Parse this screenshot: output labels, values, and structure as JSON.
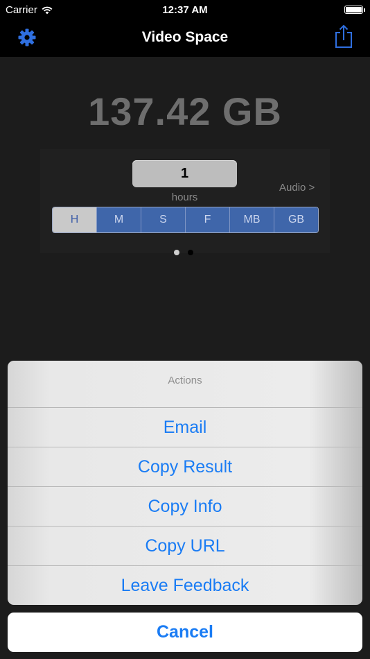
{
  "status_bar": {
    "carrier": "Carrier",
    "time": "12:37 AM",
    "battery_level": 1.0
  },
  "nav": {
    "title": "Video Space",
    "left_icon": "gear-icon",
    "right_icon": "share-icon"
  },
  "main": {
    "result": "137.42 GB",
    "input_value": "1",
    "unit_label": "hours",
    "audio_link": "Audio >",
    "segments": [
      "H",
      "M",
      "S",
      "F",
      "MB",
      "GB"
    ],
    "selected_segment": "H",
    "page_count": 2,
    "current_page": 1
  },
  "action_sheet": {
    "title": "Actions",
    "items": [
      "Email",
      "Copy Result",
      "Copy Info",
      "Copy URL",
      "Leave Feedback"
    ],
    "cancel": "Cancel"
  },
  "colors": {
    "accent": "#1a7cf4",
    "segment_blue": "#3f66aa",
    "nav_bg": "#000000",
    "body_bg": "#1c1c1c"
  }
}
